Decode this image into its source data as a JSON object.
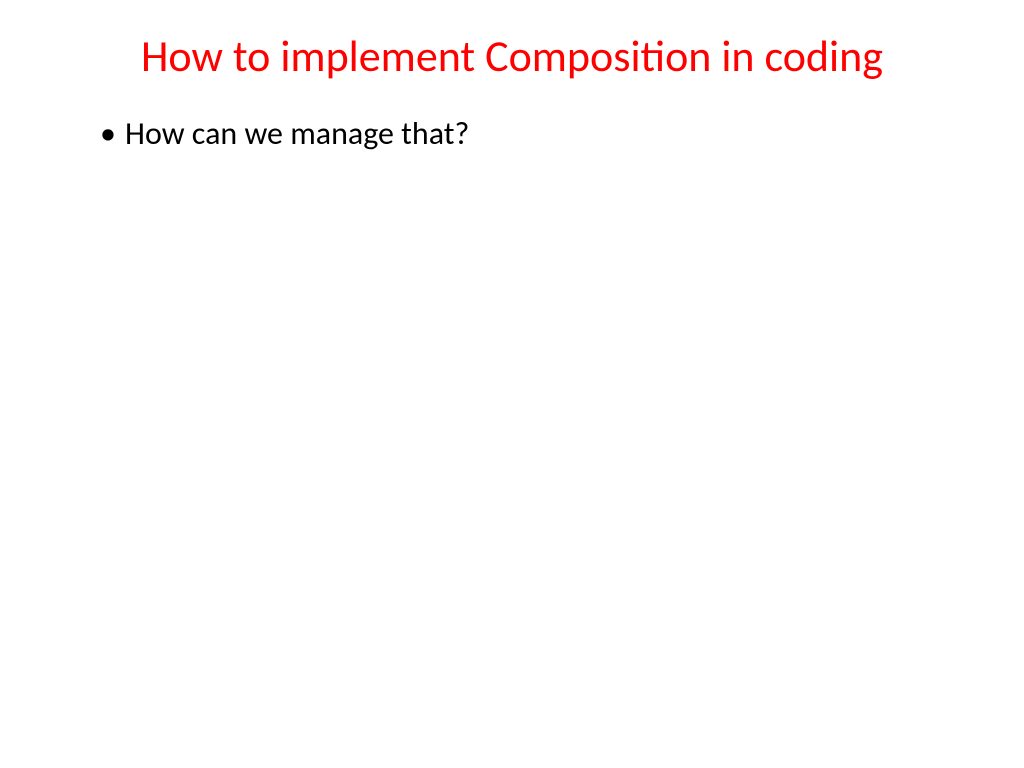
{
  "slide": {
    "title": "How to implement Composition in coding",
    "bullets": [
      "How can we manage that?"
    ]
  }
}
